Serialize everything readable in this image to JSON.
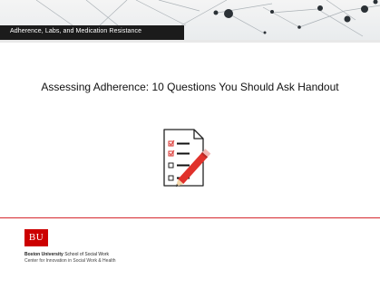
{
  "header": {
    "section_title": "Adherence, Labs, and Medication Resistance"
  },
  "slide": {
    "title": "Assessing Adherence: 10 Questions You Should Ask Handout",
    "illustration_icon": "checklist-with-pencil-icon"
  },
  "footer": {
    "logo_text": "BU",
    "university": "Boston University",
    "school": "School of Social Work",
    "center": "Center for Innovation in Social Work & Health"
  },
  "colors": {
    "section_bar": "#1b1b1b",
    "accent_red": "#cc0000",
    "rule_red": "#d6282e",
    "checkbox_red": "#d9302c"
  }
}
